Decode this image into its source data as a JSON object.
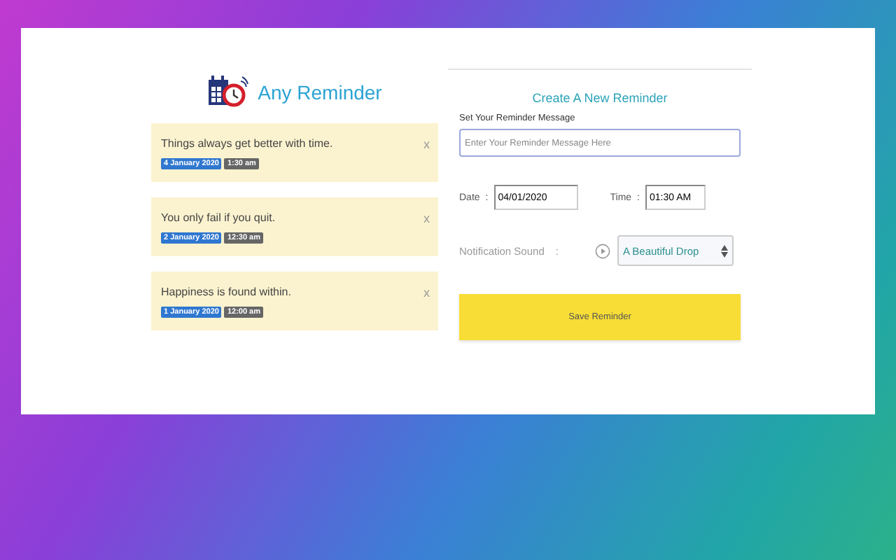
{
  "app": {
    "title": "Any Reminder"
  },
  "reminders": [
    {
      "message": "Things always get better with time.",
      "date": "4 January 2020",
      "time": "1:30 am",
      "close": "x"
    },
    {
      "message": "You only fail if you quit.",
      "date": "2 January 2020",
      "time": "12:30 am",
      "close": "x"
    },
    {
      "message": "Happiness is found within.",
      "date": "1 January 2020",
      "time": "12:00 am",
      "close": "x"
    }
  ],
  "form": {
    "title": "Create A New Reminder",
    "message_label": "Set Your Reminder Message",
    "message_placeholder": "Enter Your Reminder Message Here",
    "date_label": "Date",
    "date_separator": ":",
    "date_value": "04/01/2020",
    "time_label": "Time",
    "time_separator": ":",
    "time_value": "01:30 AM",
    "sound_label": "Notification Sound",
    "sound_separator": ":",
    "sound_value": "A Beautiful Drop",
    "save_button": "Save Reminder"
  }
}
